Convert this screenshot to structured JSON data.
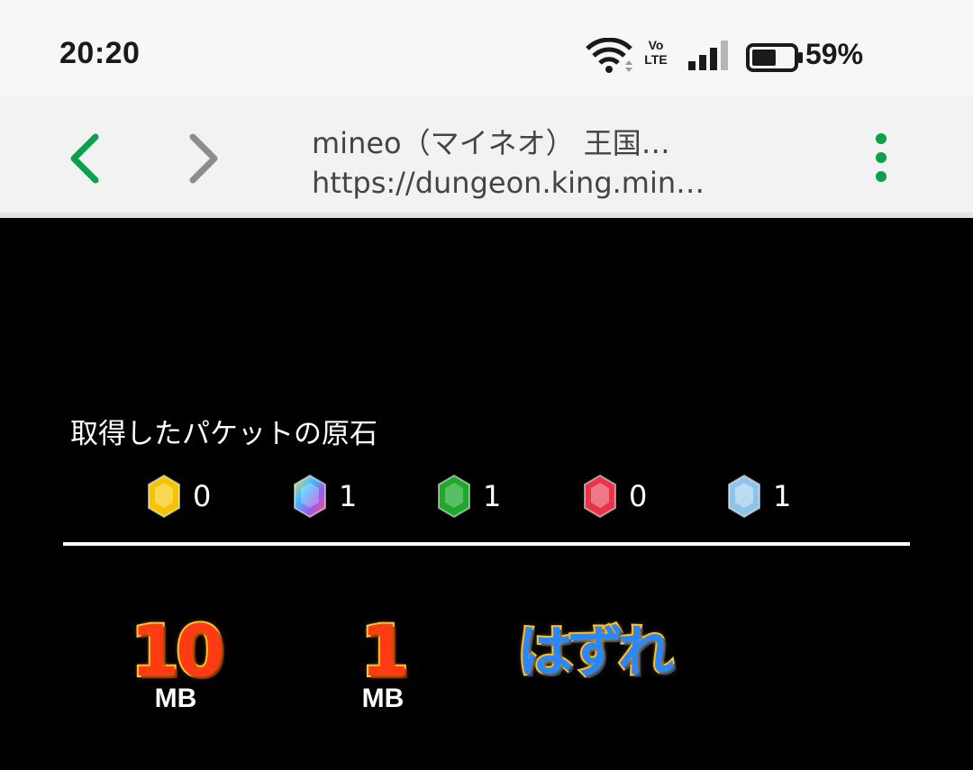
{
  "status_bar": {
    "time": "20:20",
    "network_label": "Vo\nLTE",
    "battery_percent": "59%",
    "battery_level": 0.59
  },
  "browser": {
    "title": "mineo（マイネオ） 王国…",
    "url": "https://dungeon.king.min…",
    "accent_color": "#0aa14a"
  },
  "content": {
    "section_title": "取得したパケットの原石",
    "gems": [
      {
        "icon": "yellow-gem-icon",
        "color": "#f5c400",
        "count": "0"
      },
      {
        "icon": "rainbow-gem-icon",
        "color": "#9a5ce6",
        "count": "1"
      },
      {
        "icon": "green-gem-icon",
        "color": "#1fa82c",
        "count": "1"
      },
      {
        "icon": "red-gem-icon",
        "color": "#e8344a",
        "count": "0"
      },
      {
        "icon": "blue-gem-icon",
        "color": "#8ec4ea",
        "count": "1"
      }
    ],
    "prizes": [
      {
        "value": "10",
        "unit": "MB"
      },
      {
        "value": "1",
        "unit": "MB"
      },
      {
        "value": "はずれ",
        "unit": ""
      }
    ]
  }
}
